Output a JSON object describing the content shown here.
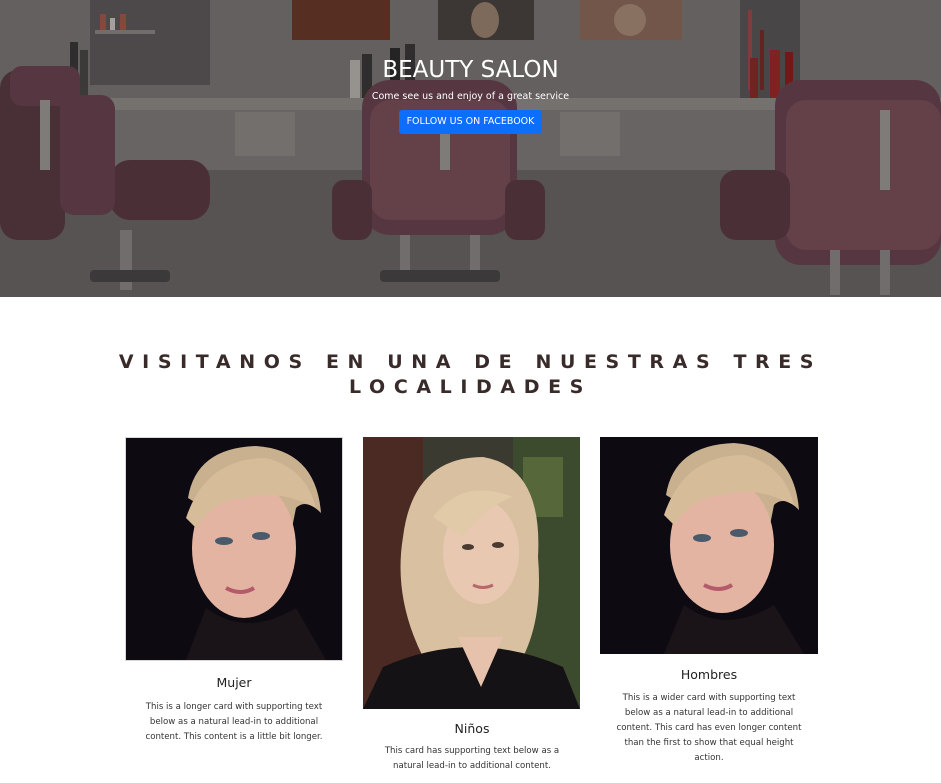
{
  "hero": {
    "title": "BEAUTY SALON",
    "subtitle": "Come see us and enjoy of a great service",
    "button_label": "FOLLOW US ON FACEBOOK"
  },
  "section": {
    "title": "VISITANOS EN UNA DE NUESTRAS TRES LOCALIDADES"
  },
  "cards": [
    {
      "title": "Mujer",
      "text": "This is a longer card with supporting text below as a natural lead-in to additional content. This content is a little bit longer."
    },
    {
      "title": "Niños",
      "text": "This card has supporting text below as a natural lead-in to additional content."
    },
    {
      "title": "Hombres",
      "text": "This is a wider card with supporting text below as a natural lead-in to additional content. This card has even longer content than the first to show that equal height action."
    }
  ],
  "colors": {
    "button": "#0d6efd",
    "heading": "#3a2b2b",
    "chair": "#7a4f58"
  }
}
